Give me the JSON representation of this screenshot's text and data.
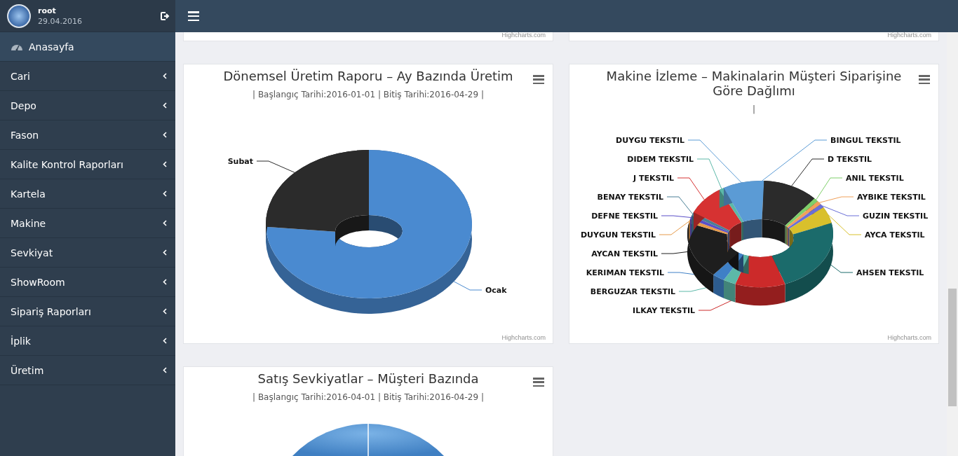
{
  "sidebar": {
    "user": {
      "name": "root",
      "date": "29.04.2016"
    },
    "items": [
      {
        "label": "Anasayfa",
        "kind": "home",
        "selected": true
      },
      {
        "label": "Cari",
        "kind": "menu",
        "selected": false
      },
      {
        "label": "Depo",
        "kind": "menu",
        "selected": false
      },
      {
        "label": "Fason",
        "kind": "menu",
        "selected": false
      },
      {
        "label": "Kalite Kontrol Raporları",
        "kind": "menu",
        "selected": false
      },
      {
        "label": "Kartela",
        "kind": "menu",
        "selected": false
      },
      {
        "label": "Makine",
        "kind": "menu",
        "selected": false
      },
      {
        "label": "Sevkiyat",
        "kind": "menu",
        "selected": false
      },
      {
        "label": "ShowRoom",
        "kind": "menu",
        "selected": false
      },
      {
        "label": "Sipariş Raporları",
        "kind": "menu",
        "selected": false
      },
      {
        "label": "İplik",
        "kind": "menu",
        "selected": false
      },
      {
        "label": "Üretim",
        "kind": "menu",
        "selected": false
      }
    ]
  },
  "top_cards": [
    {
      "credit": "Highcharts.com"
    },
    {
      "credit": "Highcharts.com"
    }
  ],
  "charts": [
    {
      "kind": "donut",
      "title": "Dönemsel Üretim Raporu – Ay Bazında Üretim",
      "subtitle": "| Başlangıç Tarihi:2016-01-01 | Bitiş Tarihi:2016-04-29 |",
      "credit": "Highcharts.com",
      "slices": [
        {
          "label": "Subat",
          "color": "#2b2b2b"
        },
        {
          "label": "Ocak",
          "color": "#4a8ad0"
        }
      ]
    },
    {
      "kind": "donut",
      "title": "Makine İzleme – Makinalarin Müşteri Siparişine Göre Dağlımı",
      "subtitle": "|",
      "credit": "Highcharts.com",
      "slices": [
        {
          "label": "DUYGU TEKSTIL",
          "color": "#5b9bd5"
        },
        {
          "label": "BINGUL TEKSTIL",
          "color": "#5b9bd5"
        },
        {
          "label": "DIDEM TEKSTIL",
          "color": "#5cb8a8"
        },
        {
          "label": "D TEKSTIL",
          "color": "#2b2b2b"
        },
        {
          "label": "J TEKSTIL",
          "color": "#d63232"
        },
        {
          "label": "ANIL TEKSTIL",
          "color": "#7fcf6a"
        },
        {
          "label": "BENAY TEKSTIL",
          "color": "#4a7f96"
        },
        {
          "label": "AYBIKE TEKSTIL",
          "color": "#f0a05a"
        },
        {
          "label": "DEFNE TEKSTIL",
          "color": "#5a4fc8"
        },
        {
          "label": "GUZIN TEKSTIL",
          "color": "#6a6fd8"
        },
        {
          "label": "DUYGUN TEKSTIL",
          "color": "#e69a4a"
        },
        {
          "label": "AYCA TEKSTIL",
          "color": "#d9c02c"
        },
        {
          "label": "AYCAN TEKSTIL",
          "color": "#1e1e1e"
        },
        {
          "label": "KERIMAN TEKSTIL",
          "color": "#3f80c6"
        },
        {
          "label": "AHSEN TEKSTIL",
          "color": "#1b6b6b"
        },
        {
          "label": "BERGUZAR TEKSTIL",
          "color": "#5cb8a8"
        },
        {
          "label": "ILKAY TEKSTIL",
          "color": "#cc2a2a"
        }
      ]
    },
    {
      "kind": "pie",
      "title": "Satış Sevkiyatlar – Müşteri Bazında",
      "subtitle": "| Başlangıç Tarihi:2016-04-01 | Bitiş Tarihi:2016-04-29 |"
    }
  ]
}
